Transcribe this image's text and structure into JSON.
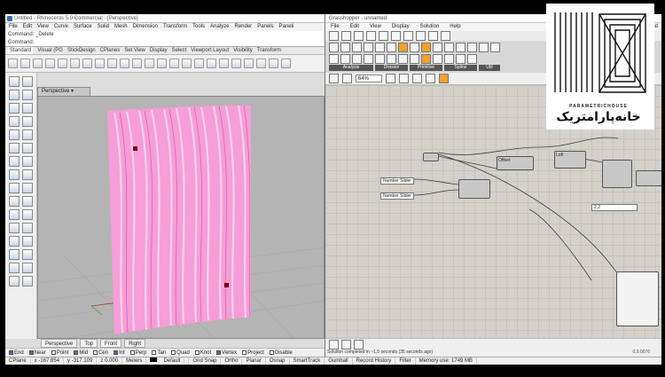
{
  "rhino": {
    "window_title": "Untitled - Rhinoceros 5.0 Commercial - [Perspective]",
    "menu": [
      "File",
      "Edit",
      "View",
      "Curve",
      "Surface",
      "Solid",
      "Mesh",
      "Dimension",
      "Transform",
      "Tools",
      "Analyze",
      "Render",
      "Panels",
      "Paneli"
    ],
    "command_history": "Command: _Delete",
    "command_prompt": "Command:",
    "toolbar_tabs": [
      "Standard",
      "Visual (PG",
      "StickDesign",
      "CPlanes",
      "Set View",
      "Display",
      "Select",
      "Viewport Layout",
      "Visibility",
      "Transform"
    ],
    "viewport_title": "Perspective",
    "viewport_tabs": [
      "Perspective",
      "Top",
      "Front",
      "Right"
    ],
    "osnaps": [
      {
        "label": "End",
        "on": true
      },
      {
        "label": "Near",
        "on": true
      },
      {
        "label": "Point",
        "on": false
      },
      {
        "label": "Mid",
        "on": true
      },
      {
        "label": "Cen",
        "on": false
      },
      {
        "label": "Int",
        "on": true
      },
      {
        "label": "Perp",
        "on": false
      },
      {
        "label": "Tan",
        "on": false
      },
      {
        "label": "Quad",
        "on": false
      },
      {
        "label": "Knot",
        "on": false
      },
      {
        "label": "Vertex",
        "on": true
      },
      {
        "label": "Project",
        "on": false
      },
      {
        "label": "Disable",
        "on": false
      }
    ]
  },
  "status_bar": {
    "cplane": "CPlane",
    "x": "x -167.854",
    "y": "y -317.109",
    "z": "z 0.000",
    "units": "Meters",
    "layer": "Default",
    "items": [
      "Grid Snap",
      "Ortho",
      "Planar",
      "Osnap",
      "SmartTrack",
      "Gumball",
      "Record History",
      "Filter",
      "Memory use: 1749 MB"
    ]
  },
  "grasshopper": {
    "window_title": "Grasshopper - unnamed",
    "doc_name": "unnamed",
    "menu": [
      "File",
      "Edit",
      "View",
      "Display",
      "Solution",
      "Help"
    ],
    "ribbon_groups": [
      "Analysis",
      "Division",
      "Primitive",
      "Spline",
      "Util"
    ],
    "zoom": "64%",
    "components": {
      "number_slider_1": "Number Slider",
      "number_slider_2": "Number Slider",
      "offset_comp": "Offset",
      "loft_comp": "Loft",
      "panel_value": "2.2"
    },
    "solution_message": "Solution completed in ~1.5 seconds (35 seconds ago)",
    "version": "0.9.0076"
  },
  "watermark": {
    "english": "PARAMETRICHOUSE",
    "persian": "خانه‌پارامتریک"
  }
}
